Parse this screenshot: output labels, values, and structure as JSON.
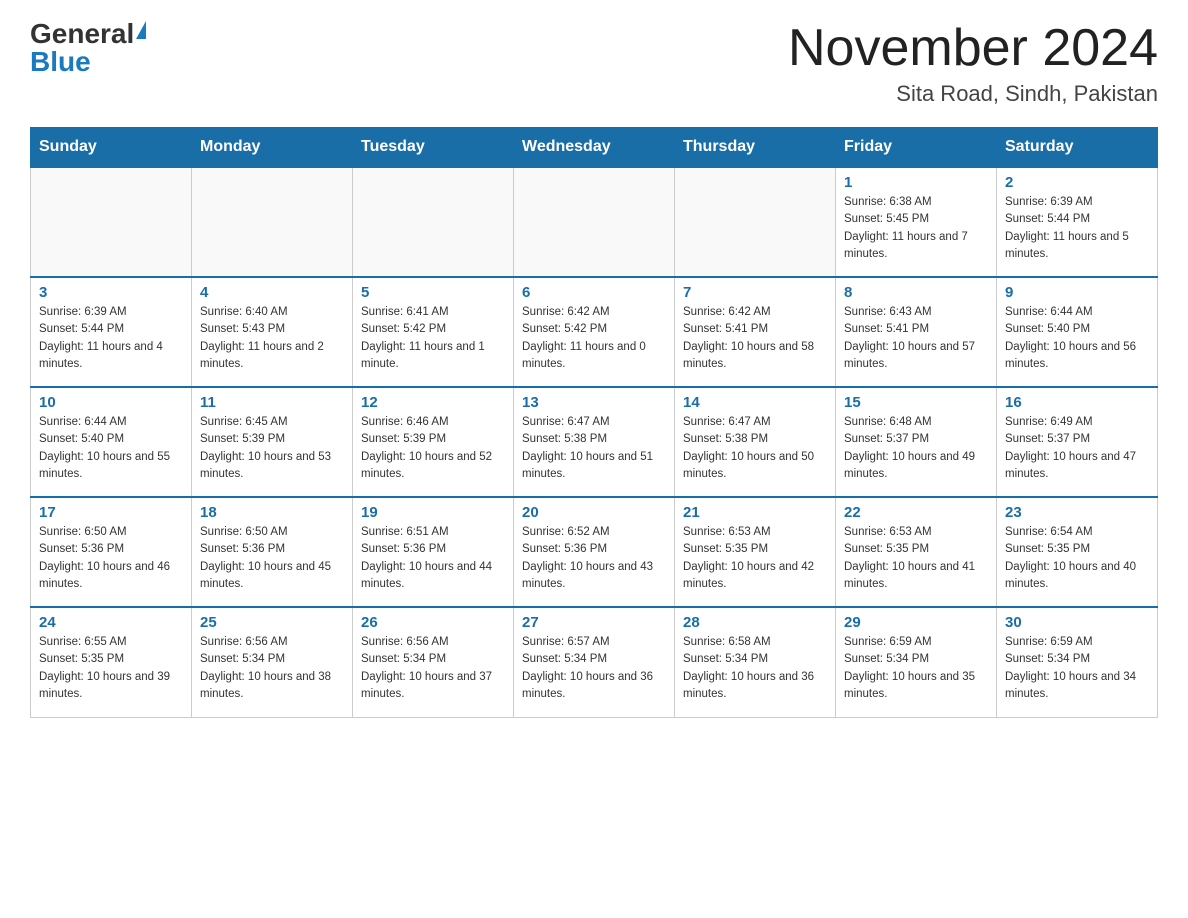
{
  "header": {
    "logo_general": "General",
    "logo_blue": "Blue",
    "month_title": "November 2024",
    "location": "Sita Road, Sindh, Pakistan"
  },
  "weekdays": [
    "Sunday",
    "Monday",
    "Tuesday",
    "Wednesday",
    "Thursday",
    "Friday",
    "Saturday"
  ],
  "weeks": [
    [
      {
        "day": "",
        "info": ""
      },
      {
        "day": "",
        "info": ""
      },
      {
        "day": "",
        "info": ""
      },
      {
        "day": "",
        "info": ""
      },
      {
        "day": "",
        "info": ""
      },
      {
        "day": "1",
        "info": "Sunrise: 6:38 AM\nSunset: 5:45 PM\nDaylight: 11 hours and 7 minutes."
      },
      {
        "day": "2",
        "info": "Sunrise: 6:39 AM\nSunset: 5:44 PM\nDaylight: 11 hours and 5 minutes."
      }
    ],
    [
      {
        "day": "3",
        "info": "Sunrise: 6:39 AM\nSunset: 5:44 PM\nDaylight: 11 hours and 4 minutes."
      },
      {
        "day": "4",
        "info": "Sunrise: 6:40 AM\nSunset: 5:43 PM\nDaylight: 11 hours and 2 minutes."
      },
      {
        "day": "5",
        "info": "Sunrise: 6:41 AM\nSunset: 5:42 PM\nDaylight: 11 hours and 1 minute."
      },
      {
        "day": "6",
        "info": "Sunrise: 6:42 AM\nSunset: 5:42 PM\nDaylight: 11 hours and 0 minutes."
      },
      {
        "day": "7",
        "info": "Sunrise: 6:42 AM\nSunset: 5:41 PM\nDaylight: 10 hours and 58 minutes."
      },
      {
        "day": "8",
        "info": "Sunrise: 6:43 AM\nSunset: 5:41 PM\nDaylight: 10 hours and 57 minutes."
      },
      {
        "day": "9",
        "info": "Sunrise: 6:44 AM\nSunset: 5:40 PM\nDaylight: 10 hours and 56 minutes."
      }
    ],
    [
      {
        "day": "10",
        "info": "Sunrise: 6:44 AM\nSunset: 5:40 PM\nDaylight: 10 hours and 55 minutes."
      },
      {
        "day": "11",
        "info": "Sunrise: 6:45 AM\nSunset: 5:39 PM\nDaylight: 10 hours and 53 minutes."
      },
      {
        "day": "12",
        "info": "Sunrise: 6:46 AM\nSunset: 5:39 PM\nDaylight: 10 hours and 52 minutes."
      },
      {
        "day": "13",
        "info": "Sunrise: 6:47 AM\nSunset: 5:38 PM\nDaylight: 10 hours and 51 minutes."
      },
      {
        "day": "14",
        "info": "Sunrise: 6:47 AM\nSunset: 5:38 PM\nDaylight: 10 hours and 50 minutes."
      },
      {
        "day": "15",
        "info": "Sunrise: 6:48 AM\nSunset: 5:37 PM\nDaylight: 10 hours and 49 minutes."
      },
      {
        "day": "16",
        "info": "Sunrise: 6:49 AM\nSunset: 5:37 PM\nDaylight: 10 hours and 47 minutes."
      }
    ],
    [
      {
        "day": "17",
        "info": "Sunrise: 6:50 AM\nSunset: 5:36 PM\nDaylight: 10 hours and 46 minutes."
      },
      {
        "day": "18",
        "info": "Sunrise: 6:50 AM\nSunset: 5:36 PM\nDaylight: 10 hours and 45 minutes."
      },
      {
        "day": "19",
        "info": "Sunrise: 6:51 AM\nSunset: 5:36 PM\nDaylight: 10 hours and 44 minutes."
      },
      {
        "day": "20",
        "info": "Sunrise: 6:52 AM\nSunset: 5:36 PM\nDaylight: 10 hours and 43 minutes."
      },
      {
        "day": "21",
        "info": "Sunrise: 6:53 AM\nSunset: 5:35 PM\nDaylight: 10 hours and 42 minutes."
      },
      {
        "day": "22",
        "info": "Sunrise: 6:53 AM\nSunset: 5:35 PM\nDaylight: 10 hours and 41 minutes."
      },
      {
        "day": "23",
        "info": "Sunrise: 6:54 AM\nSunset: 5:35 PM\nDaylight: 10 hours and 40 minutes."
      }
    ],
    [
      {
        "day": "24",
        "info": "Sunrise: 6:55 AM\nSunset: 5:35 PM\nDaylight: 10 hours and 39 minutes."
      },
      {
        "day": "25",
        "info": "Sunrise: 6:56 AM\nSunset: 5:34 PM\nDaylight: 10 hours and 38 minutes."
      },
      {
        "day": "26",
        "info": "Sunrise: 6:56 AM\nSunset: 5:34 PM\nDaylight: 10 hours and 37 minutes."
      },
      {
        "day": "27",
        "info": "Sunrise: 6:57 AM\nSunset: 5:34 PM\nDaylight: 10 hours and 36 minutes."
      },
      {
        "day": "28",
        "info": "Sunrise: 6:58 AM\nSunset: 5:34 PM\nDaylight: 10 hours and 36 minutes."
      },
      {
        "day": "29",
        "info": "Sunrise: 6:59 AM\nSunset: 5:34 PM\nDaylight: 10 hours and 35 minutes."
      },
      {
        "day": "30",
        "info": "Sunrise: 6:59 AM\nSunset: 5:34 PM\nDaylight: 10 hours and 34 minutes."
      }
    ]
  ]
}
